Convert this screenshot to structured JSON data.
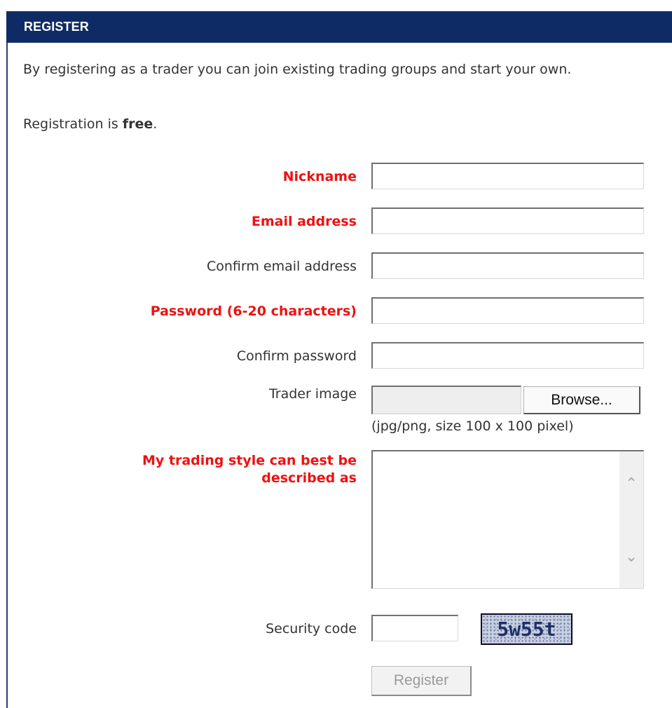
{
  "header": {
    "title": "REGISTER"
  },
  "intro": {
    "text": "By registering as a trader you can join existing trading groups and start your own.",
    "free_prefix": "Registration is ",
    "free_bold": "free",
    "free_suffix": "."
  },
  "form": {
    "nickname_label": "Nickname",
    "email_label": "Email address",
    "confirm_email_label": "Confirm email address",
    "password_label": "Password (6-20 characters)",
    "confirm_password_label": "Confirm password",
    "trader_image_label": "Trader image",
    "browse_label": "Browse...",
    "image_hint": "(jpg/png, size 100 x 100 pixel)",
    "trading_style_label_line1": "My trading style can best be",
    "trading_style_label_line2": "described as",
    "security_code_label": "Security code",
    "captcha_text": "5w55t",
    "register_label": "Register"
  },
  "icons": {
    "scroll_up": "chevron-up-icon",
    "scroll_down": "chevron-down-icon"
  },
  "colors": {
    "header_bg": "#0f2b66",
    "required_label": "#ee1111"
  }
}
